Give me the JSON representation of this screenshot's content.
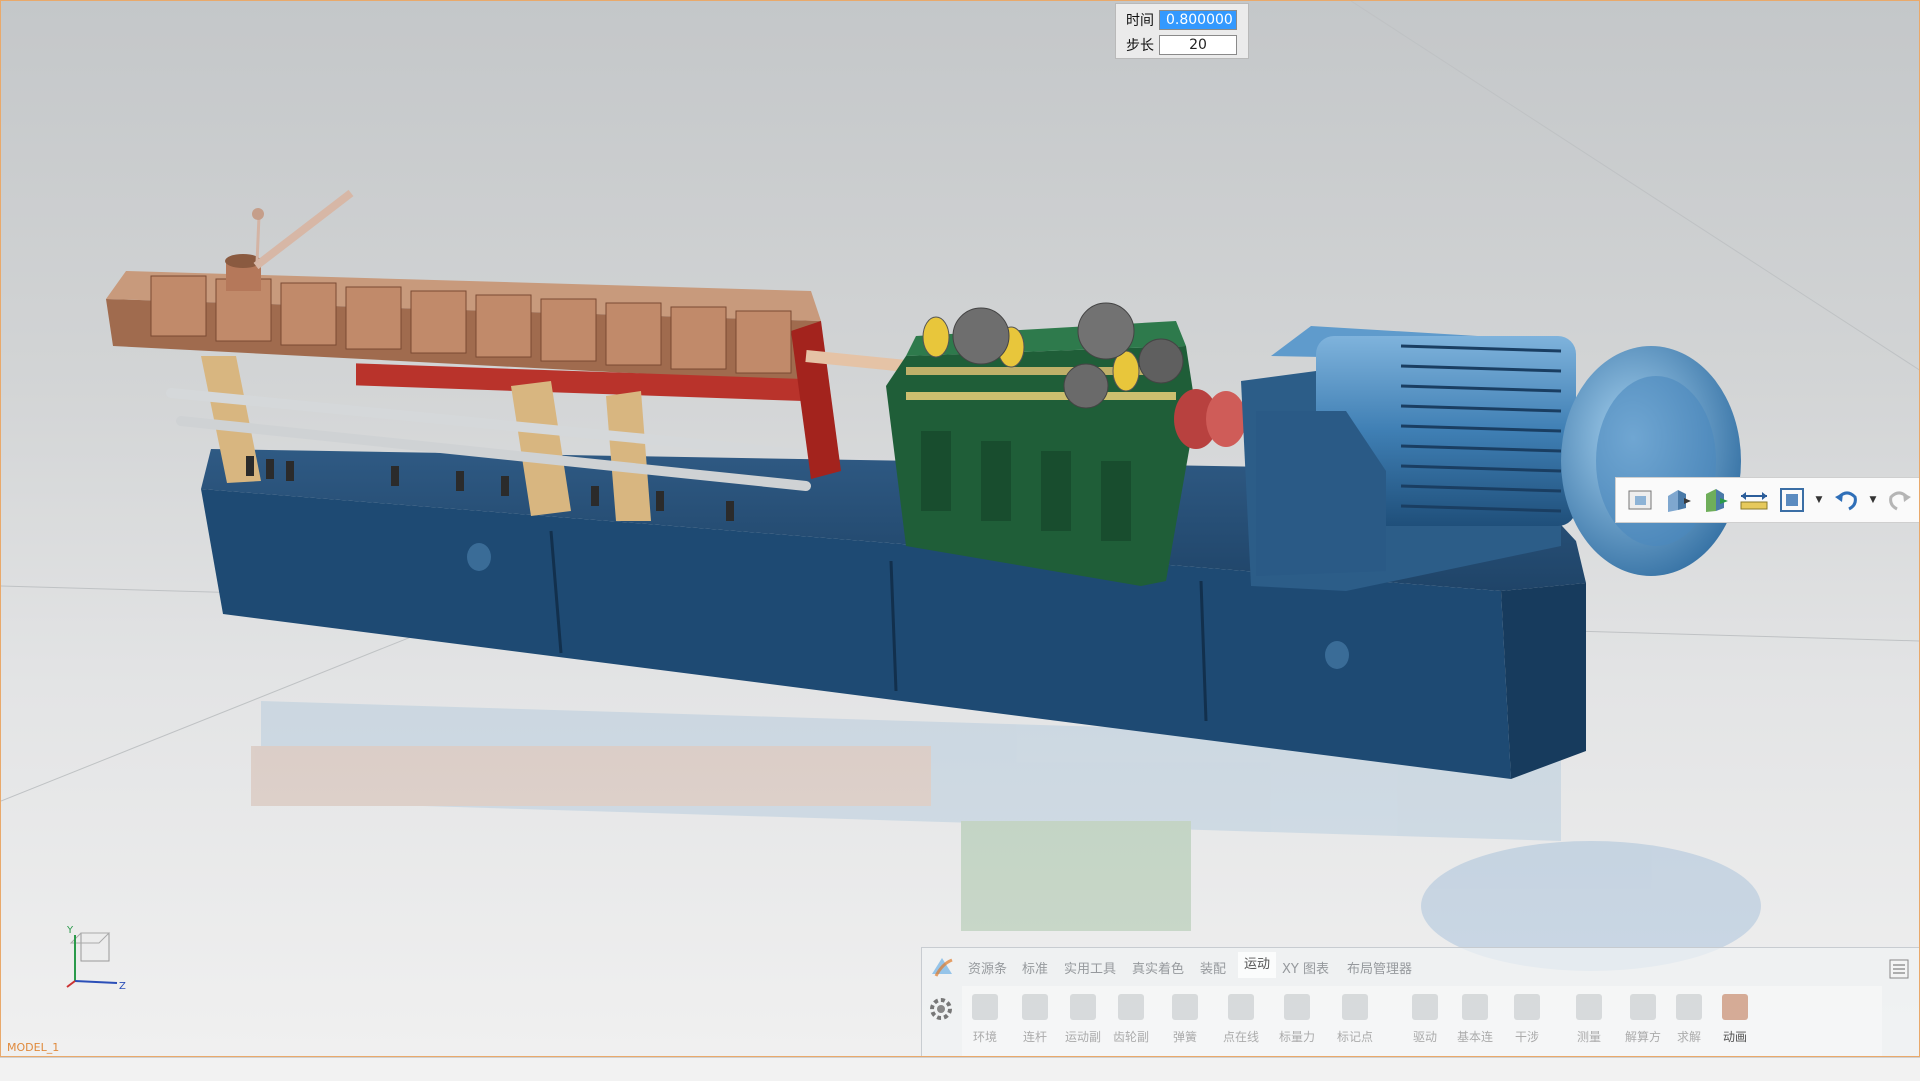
{
  "simulation": {
    "time_label": "时间",
    "time_value": "0.800000",
    "step_label": "步长",
    "step_value": "20"
  },
  "ribbon": {
    "tabs": [
      {
        "label": "资源条"
      },
      {
        "label": "标准"
      },
      {
        "label": "实用工具"
      },
      {
        "label": "真实着色"
      },
      {
        "label": "装配"
      },
      {
        "label": "运动"
      },
      {
        "label": "XY 图表"
      },
      {
        "label": "布局管理器"
      }
    ],
    "active_tab": "运动",
    "buttons": [
      {
        "label": "环境",
        "icon": "environment-icon"
      },
      {
        "label": "连杆",
        "icon": "link-icon"
      },
      {
        "label": "运动副",
        "icon": "joint-icon"
      },
      {
        "label": "齿轮副",
        "icon": "gear-pair-icon"
      },
      {
        "label": "弹簧",
        "icon": "spring-icon"
      },
      {
        "label": "点在线",
        "icon": "point-on-curve-icon"
      },
      {
        "label": "标量力",
        "icon": "scalar-force-icon"
      },
      {
        "label": "标记点",
        "icon": "marker-icon"
      },
      {
        "label": "驱动",
        "icon": "driver-icon"
      },
      {
        "label": "基本连",
        "icon": "basic-connect-icon"
      },
      {
        "label": "干涉",
        "icon": "interference-icon"
      },
      {
        "label": "测量",
        "icon": "measure-icon"
      },
      {
        "label": "解算方",
        "icon": "solver-icon"
      },
      {
        "label": "求解",
        "icon": "solve-icon"
      },
      {
        "label": "动画",
        "icon": "animation-icon"
      }
    ]
  },
  "viewport": {
    "model_name": "MODEL_1",
    "triad_axes": [
      "Y",
      "Z"
    ]
  },
  "colors": {
    "viewport_border": "#e9a96b",
    "selection": "#3399ff",
    "model_label": "#e08a3c"
  }
}
